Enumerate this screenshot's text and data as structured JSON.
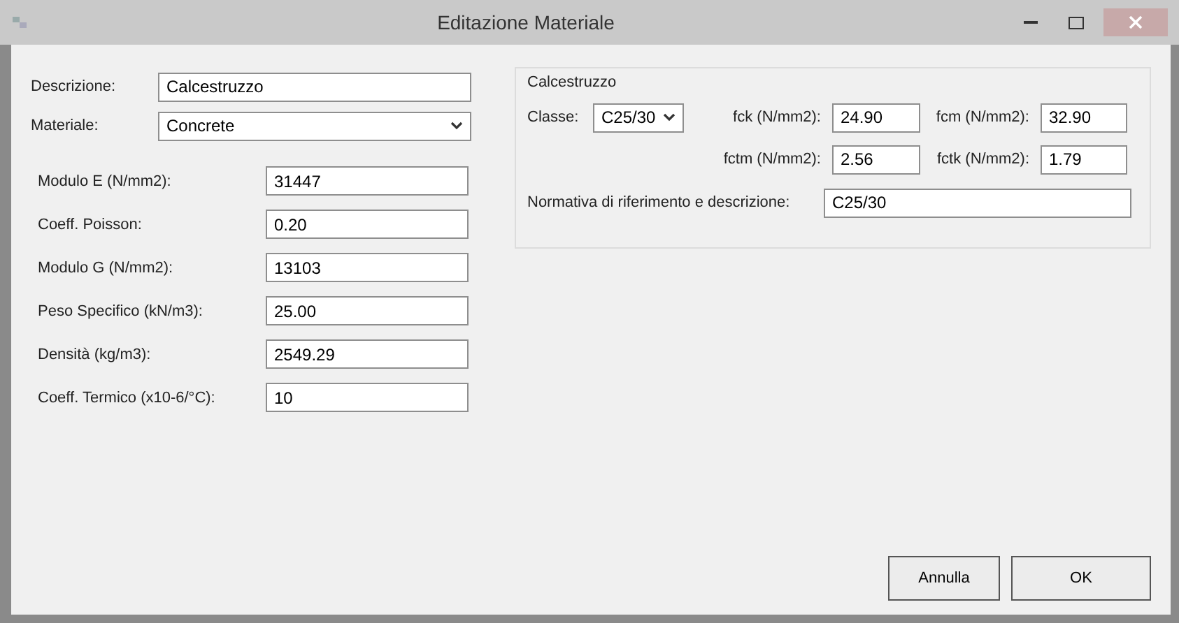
{
  "window": {
    "title": "Editazione Materiale"
  },
  "general": [
    {
      "label": "Descrizione:",
      "kind": "text",
      "value": "Calcestruzzo"
    },
    {
      "label": "Materiale:",
      "kind": "select",
      "value": "Concrete"
    }
  ],
  "properties": [
    {
      "label": "Modulo E (N/mm2):",
      "value": "31447"
    },
    {
      "label": "Coeff. Poisson:",
      "value": "0.20"
    },
    {
      "label": "Modulo G (N/mm2):",
      "value": "13103"
    },
    {
      "label": "Peso Specifico (kN/m3):",
      "value": "25.00"
    },
    {
      "label": "Densità (kg/m3):",
      "value": "2549.29"
    },
    {
      "label": "Coeff. Termico (x10-6/°C):",
      "value": "10"
    }
  ],
  "concrete": {
    "title": "Calcestruzzo",
    "class_label": "Classe:",
    "class_value": "C25/30",
    "strengths": [
      {
        "label": "fck (N/mm2):",
        "value": "24.90"
      },
      {
        "label": "fcm (N/mm2):",
        "value": "32.90"
      },
      {
        "label": "fctm (N/mm2):",
        "value": "2.56"
      },
      {
        "label": "fctk (N/mm2):",
        "value": "1.79"
      }
    ],
    "norm_label": "Normativa di riferimento e descrizione:",
    "norm_value": "C25/30"
  },
  "buttons": [
    "Annulla",
    "OK"
  ]
}
